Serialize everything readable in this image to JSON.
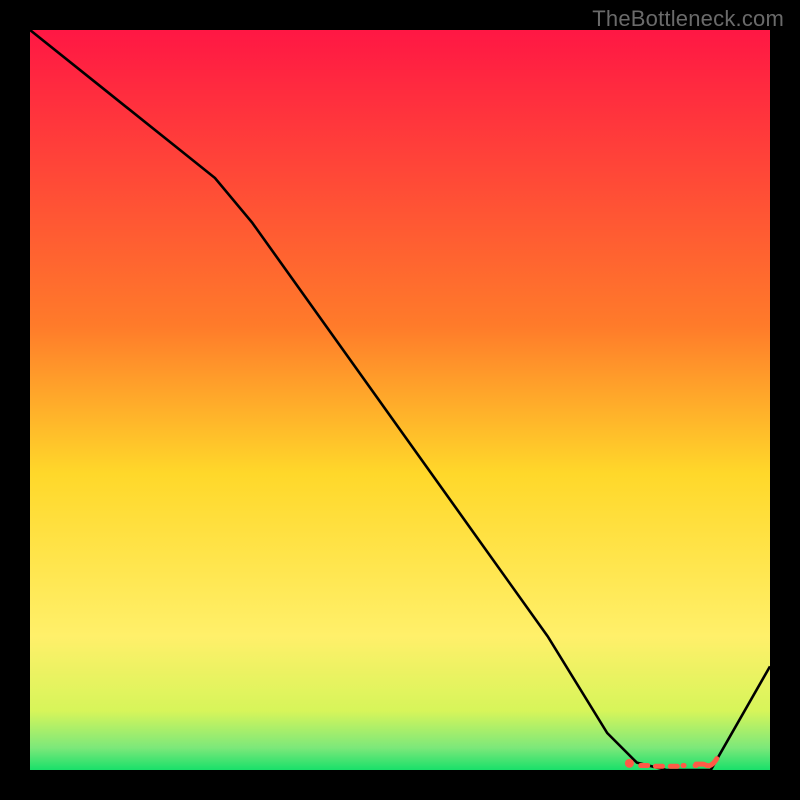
{
  "watermark": "TheBottleneck.com",
  "chart_data": {
    "type": "line",
    "title": "",
    "xlabel": "",
    "ylabel": "",
    "xlim": [
      0,
      100
    ],
    "ylim": [
      0,
      100
    ],
    "grid": false,
    "legend": false,
    "background_gradient": {
      "stops": [
        {
          "offset": 0,
          "color": "#ff1744"
        },
        {
          "offset": 0.4,
          "color": "#ff7b2a"
        },
        {
          "offset": 0.6,
          "color": "#ffd82a"
        },
        {
          "offset": 0.82,
          "color": "#fff06a"
        },
        {
          "offset": 0.92,
          "color": "#d7f55a"
        },
        {
          "offset": 0.97,
          "color": "#7ce87a"
        },
        {
          "offset": 1.0,
          "color": "#19e06a"
        }
      ]
    },
    "series": [
      {
        "name": "curve",
        "color": "#000000",
        "x": [
          0,
          10,
          20,
          25,
          30,
          40,
          50,
          60,
          70,
          78,
          82,
          86,
          90,
          92,
          100
        ],
        "y": [
          100,
          92,
          84,
          80,
          74,
          60,
          46,
          32,
          18,
          5,
          1,
          0,
          0,
          0,
          14
        ]
      }
    ],
    "markers": [
      {
        "shape": "dot",
        "color": "#ff5a46",
        "x": 81,
        "y": 0.9
      },
      {
        "shape": "dash",
        "color": "#ff5a46",
        "x": 83,
        "y": 0.6
      },
      {
        "shape": "dash",
        "color": "#ff5a46",
        "x": 85,
        "y": 0.5
      },
      {
        "shape": "dash",
        "color": "#ff5a46",
        "x": 87,
        "y": 0.5
      },
      {
        "shape": "gap",
        "color": "#ff5a46",
        "x": 89,
        "y": 0.6
      },
      {
        "shape": "dash",
        "color": "#ff5a46",
        "x": 90.5,
        "y": 0.8
      },
      {
        "shape": "hook",
        "color": "#ff5a46",
        "x": 92,
        "y": 1.0
      }
    ]
  }
}
